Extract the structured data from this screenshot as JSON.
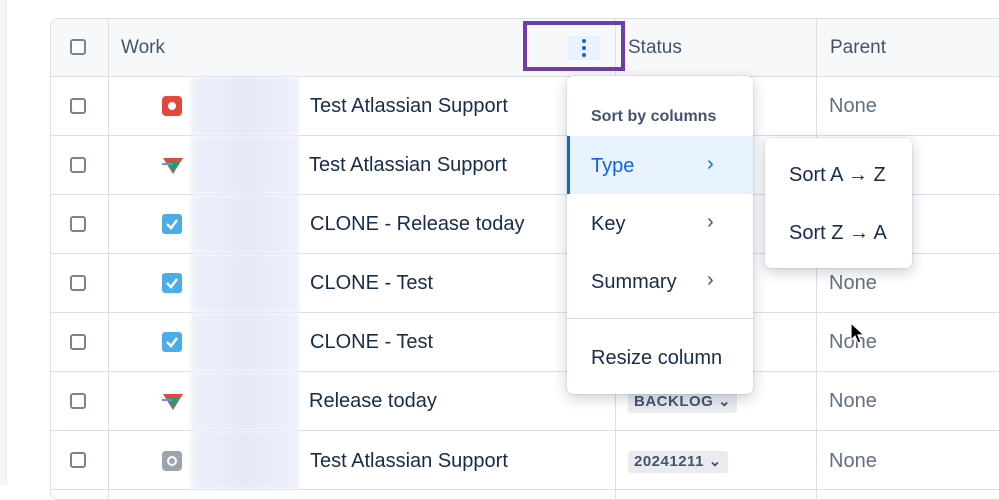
{
  "table": {
    "headers": {
      "work": "Work",
      "status": "Status",
      "parent": "Parent"
    },
    "rows": [
      {
        "type_icon": "bug-icon",
        "summary": "Test Atlassian Support",
        "status": "",
        "parent": "None"
      },
      {
        "type_icon": "filter-icon",
        "summary": "Test Atlassian Support",
        "status": "",
        "parent": ""
      },
      {
        "type_icon": "checkbox-task-icon",
        "summary": "CLONE - Release today",
        "status": "",
        "parent": ""
      },
      {
        "type_icon": "checkbox-task-icon",
        "summary": "CLONE - Test",
        "status": "",
        "parent": "None"
      },
      {
        "type_icon": "checkbox-task-icon",
        "summary": "CLONE - Test",
        "status": "",
        "parent": "None"
      },
      {
        "type_icon": "filter-icon",
        "summary": "Release today",
        "status": "BACKLOG",
        "parent": "None"
      },
      {
        "type_icon": "circle-icon",
        "summary": "Test Atlassian Support",
        "status": "20241211",
        "parent": "None"
      }
    ]
  },
  "column_menu": {
    "heading": "Sort by columns",
    "items": [
      {
        "label": "Type",
        "selected": true
      },
      {
        "label": "Key"
      },
      {
        "label": "Summary"
      }
    ],
    "resize_label": "Resize column"
  },
  "sort_submenu": {
    "items": [
      "Sort A → Z",
      "Sort Z → A"
    ]
  },
  "colors": {
    "highlight": "#6f3da8",
    "accent": "#0c66e4"
  }
}
